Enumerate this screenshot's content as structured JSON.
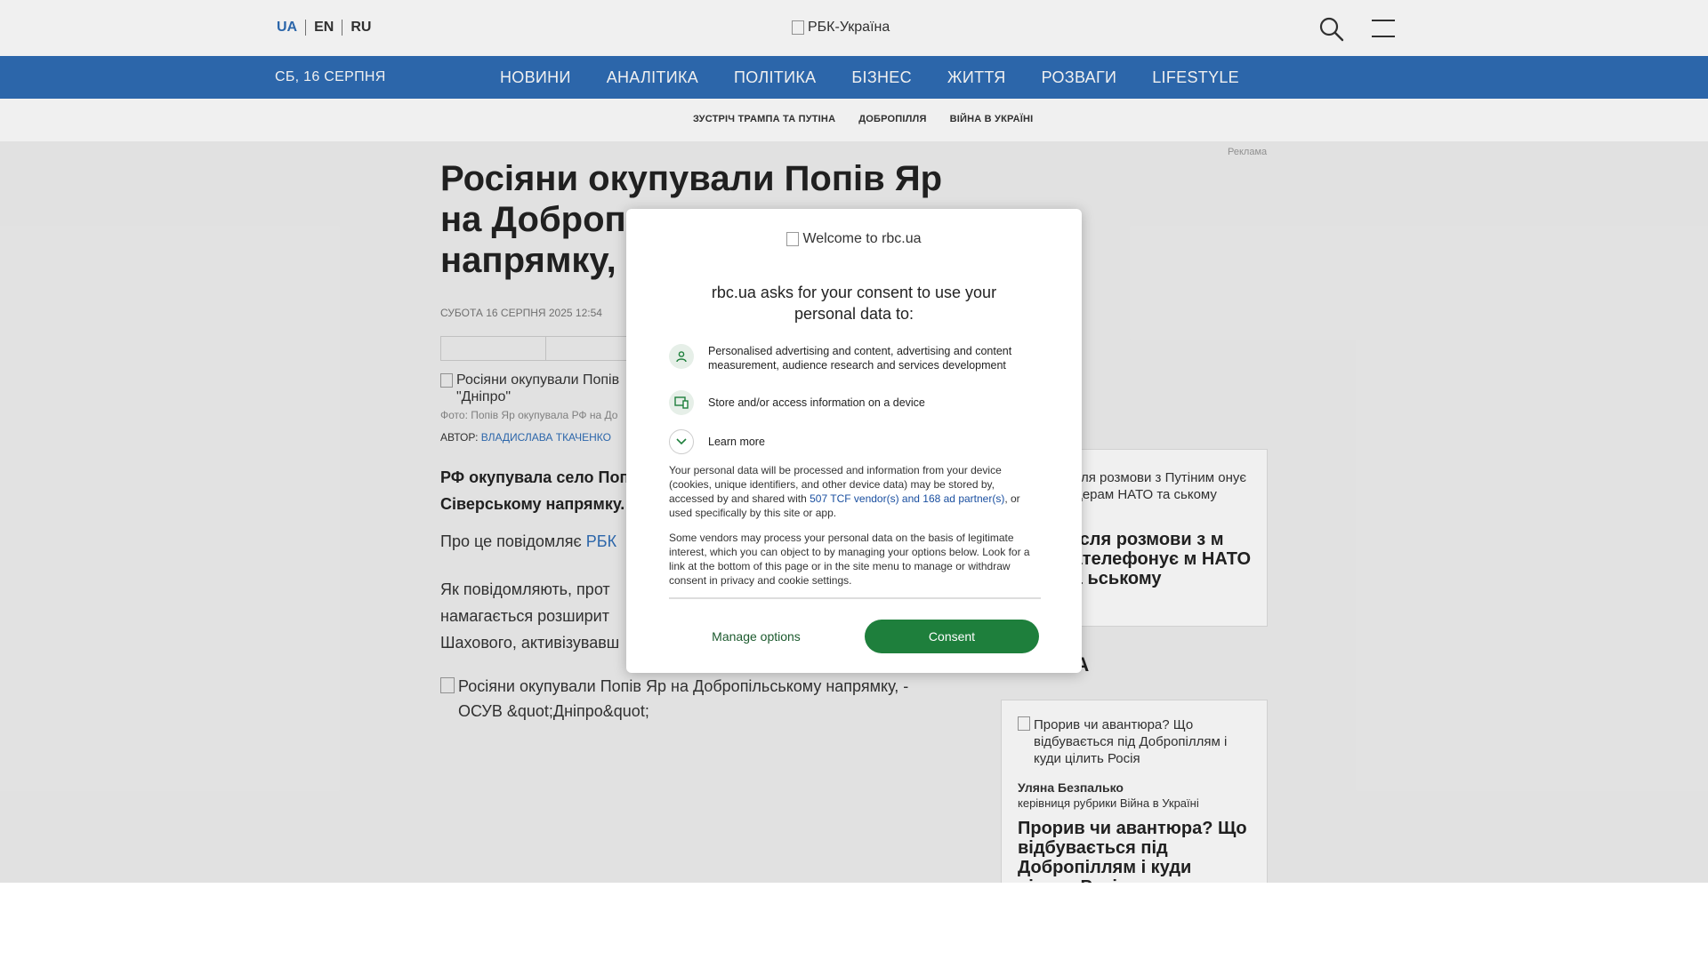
{
  "header": {
    "languages": [
      {
        "label": "UA",
        "active": true
      },
      {
        "label": "EN",
        "active": false
      },
      {
        "label": "RU",
        "active": false
      }
    ],
    "logo_alt": "РБК-Україна"
  },
  "nav": {
    "date": "СБ, 16 СЕРПНЯ",
    "items": [
      "НОВИНИ",
      "АНАЛІТИКА",
      "ПОЛІТИКА",
      "БІЗНЕС",
      "ЖИТТЯ",
      "РОЗВАГИ",
      "LIFESTYLE"
    ]
  },
  "tags": [
    "ЗУСТРІЧ ТРАМПА ТА ПУТІНА",
    "ДОБРОПІЛЛЯ",
    "ВІЙНА В УКРАЇНІ"
  ],
  "ad_label": "Реклама",
  "article": {
    "title": "Росіяни окупували Попів Яр на Доброп… напрямку,",
    "title_line1": "Росіяни окупували Попів Яр",
    "title_line2": "на Доброп",
    "title_line3": "напрямку,",
    "date": "СУБОТА 16 СЕРПНЯ 2025 12:54",
    "main_image_alt": "Росіяни окупували Попів \"Дніпро\"",
    "photo_caption": "Фото: Попів Яр окупувала РФ на До",
    "author_label": "АВТОР:",
    "author_name": "ВЛАДИСЛАВА ТКАЧЕНКО",
    "lead": "РФ окупувала село Поп Сіверському напрямку.",
    "body1_prefix": "Про це повідомляє",
    "body1_link": "РБК",
    "body2": "Як повідомляють, прот намагається розширит Шахового, активізувавш",
    "inline_image_alt": "Росіяни окупували Попів Яр на Добропільському напрямку, - ОСУВ &quot;Дніпро&quot;"
  },
  "sidebar": {
    "card1_small": "після розмови з Путіним онує лідерам НАТО та ському",
    "card1_big": "після розмови з м зателефонує м НАТО та ьському",
    "section_head": "КА",
    "card2": {
      "image_alt": "Прорив чи авантюра? Що відбувається під Добропіллям і куди цілить Росія",
      "author_name": "Уляна Безпалько",
      "author_role": "керівниця рубрики Війна в Україні",
      "title": "Прорив чи авантюра? Що відбувається під Добропіллям і куди цілить Росія"
    }
  },
  "consent": {
    "brand_alt": "Welcome to rbc.ua",
    "heading": "rbc.ua asks for your consent to use your personal data to:",
    "purposes": [
      {
        "icon": "person-icon",
        "text": "Personalised advertising and content, advertising and content measurement, audience research and services development"
      },
      {
        "icon": "device-icon",
        "text": "Store and/or access information on a device"
      }
    ],
    "learn_more": "Learn more",
    "para1_before": "Your personal data will be processed and information from your device (cookies, unique identifiers, and other device data) may be stored by, accessed by and shared with",
    "para1_link": "507 TCF vendor(s) and 168 ad partner(s)",
    "para1_after": ", or used specifically by this site or app.",
    "para2": "Some vendors may process your personal data on the basis of legitimate interest, which you can object to by managing your options below. Look for a link at the bottom of this page or in the site menu to manage or withdraw consent in privacy and cookie settings.",
    "manage_label": "Manage options",
    "consent_label": "Consent",
    "accent_color": "#1e7f3c"
  },
  "colors": {
    "brand_blue": "#2f6db5",
    "consent_green": "#1e7f3c"
  }
}
